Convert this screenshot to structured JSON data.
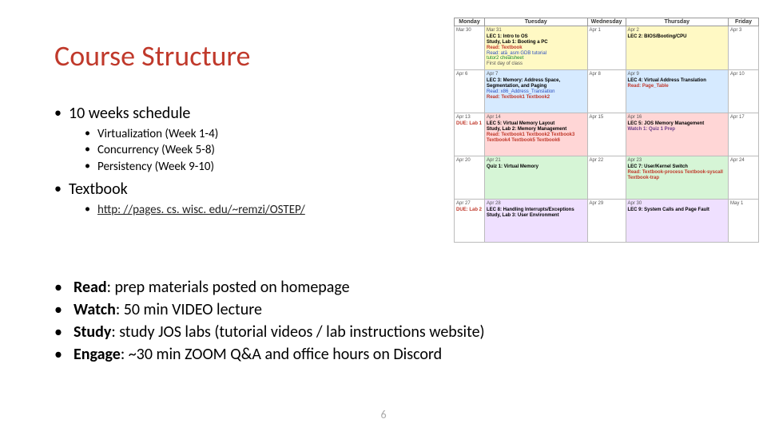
{
  "title": "Course Structure",
  "page_number": "6",
  "bullets": {
    "schedule": {
      "label": "10 weeks schedule",
      "subs": {
        "a": "Virtualization (Week 1-4)",
        "b": "Concurrency (Week 5-8)",
        "c": "Persistency (Week 9-10)"
      }
    },
    "textbook": {
      "label": "Textbook",
      "link": "http: //pages. cs. wisc. edu/~remzi/OSTEP/"
    },
    "read": {
      "label": "Read",
      "text": ": prep materials posted on homepage"
    },
    "watch": {
      "label": "Watch",
      "text": ": 50 min VIDEO lecture"
    },
    "study": {
      "label": "Study",
      "text": ": study JOS labs (tutorial videos / lab instructions website)"
    },
    "engage": {
      "label": "Engage",
      "text": ": ~30 min ZOOM Q&A and office hours on Discord"
    }
  },
  "calendar": {
    "headers": {
      "mon": "Monday",
      "tue": "Tuesday",
      "wed": "Wednesday",
      "thu": "Thursday",
      "fri": "Friday"
    },
    "w1": {
      "mon": {
        "date": "Mar 30"
      },
      "tue": {
        "date": "Mar 31",
        "lec": "LEC 1: Intro to OS",
        "study": "Study, Lab 1: Booting a PC",
        "read": "Read: Textbook",
        "blue": "Read: atā_asm GDB tutorial",
        "green": "tutor2 cheatsheet",
        "extra": "First day of class"
      },
      "wed": {
        "date": "Apr 1"
      },
      "thu": {
        "date": "Apr 2",
        "lec": "LEC 2: BIOS/Booting/CPU"
      },
      "fri": {
        "date": "Apr 3"
      }
    },
    "w2": {
      "mon": {
        "date": "Apr 6"
      },
      "tue": {
        "date": "Apr 7",
        "lec": "LEC 3: Memory: Address Space, Segmentation, and Paging",
        "blue": "Read: x86_Address_Translation",
        "read": "Read: Textbook1 Textbook2"
      },
      "wed": {
        "date": "Apr 8"
      },
      "thu": {
        "date": "Apr 9",
        "lec": "LEC 4: Virtual Address Translation",
        "read": "Read: Page_Table"
      },
      "fri": {
        "date": "Apr 10"
      }
    },
    "w3": {
      "mon": {
        "date": "Apr 13",
        "due": "DUE: Lab 1"
      },
      "tue": {
        "date": "Apr 14",
        "lec": "LEC 5: Virtual Memory Layout",
        "study": "Study, Lab 2: Memory Management",
        "read": "Read: Textbook1 Textbook2 Textbook3 Textbook4 Textbook5 Textbook6"
      },
      "wed": {
        "date": "Apr 15"
      },
      "thu": {
        "date": "Apr 16",
        "lec": "LEC 5: JOS Memory Management",
        "purple": "Watch 1: Quiz 1 Prep"
      },
      "fri": {
        "date": "Apr 17"
      }
    },
    "w4": {
      "mon": {
        "date": "Apr 20"
      },
      "tue": {
        "date": "Apr 21",
        "lec": "Quiz 1: Virtual Memory"
      },
      "wed": {
        "date": "Apr 22"
      },
      "thu": {
        "date": "Apr 23",
        "lec": "LEC 7: User/Kernel Switch",
        "read": "Read: Textbook-process Textbook-syscall Textbook-trap"
      },
      "fri": {
        "date": "Apr 24"
      }
    },
    "w5": {
      "mon": {
        "date": "Apr 27",
        "due": "DUE: Lab 2"
      },
      "tue": {
        "date": "Apr 28",
        "lec": "LEC 8: Handling Interrupts/Exceptions",
        "study": "Study, Lab 3: User Environment"
      },
      "wed": {
        "date": "Apr 29"
      },
      "thu": {
        "date": "Apr 30",
        "lec": "LEC 9: System Calls and Page Fault"
      },
      "fri": {
        "date": "May 1"
      }
    }
  }
}
